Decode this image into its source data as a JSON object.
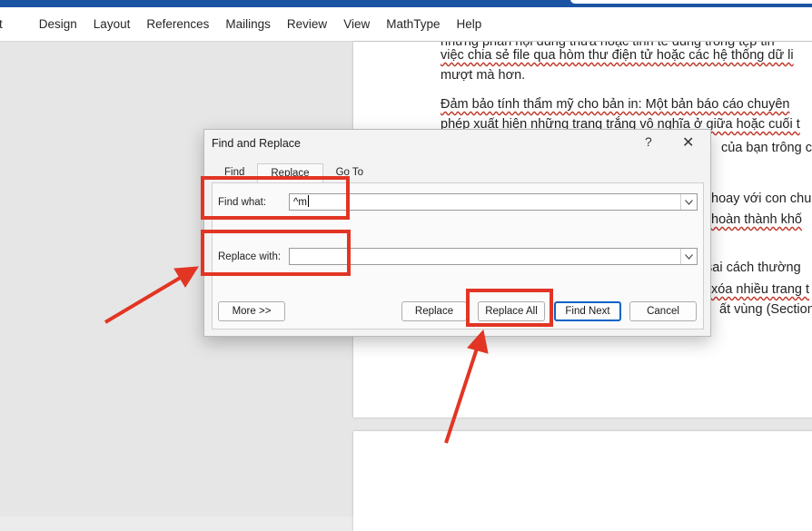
{
  "ribbon": {
    "tabs": [
      "t",
      "Design",
      "Layout",
      "References",
      "Mailings",
      "Review",
      "View",
      "MathType",
      "Help"
    ]
  },
  "document": {
    "lines": [
      "những phần nội dung thừa hoặc tinh tế dùng trong tệp tin",
      "việc chia sẻ file qua hòm thư điện tử hoặc các hệ thống dữ li",
      "mượt mà hơn.",
      "Đảm bảo tính thẩm mỹ cho bản in: Một bản báo cáo chuyên",
      "phép xuất hiện những trang trắng vô nghĩa ở giữa hoặc cuối t",
      "của bạn trông chi",
      "hoay với con chu",
      "hoàn thành khố",
      "sai cách thường",
      "xóa nhiều trang t",
      "ất vùng (Section B"
    ]
  },
  "dialog": {
    "title": "Find and Replace",
    "help": "?",
    "close": "✕",
    "tabs": [
      "Find",
      "Replace",
      "Go To"
    ],
    "find_label": "Find what:",
    "find_value": "^m",
    "replace_label": "Replace with:",
    "replace_value": "",
    "buttons": {
      "more": "More >>",
      "replace": "Replace",
      "replace_all": "Replace All",
      "find_next": "Find Next",
      "cancel": "Cancel"
    }
  },
  "colors": {
    "title_bar": "#1b53a3",
    "highlight": "#e23524",
    "default_button": "#0d63c8"
  }
}
